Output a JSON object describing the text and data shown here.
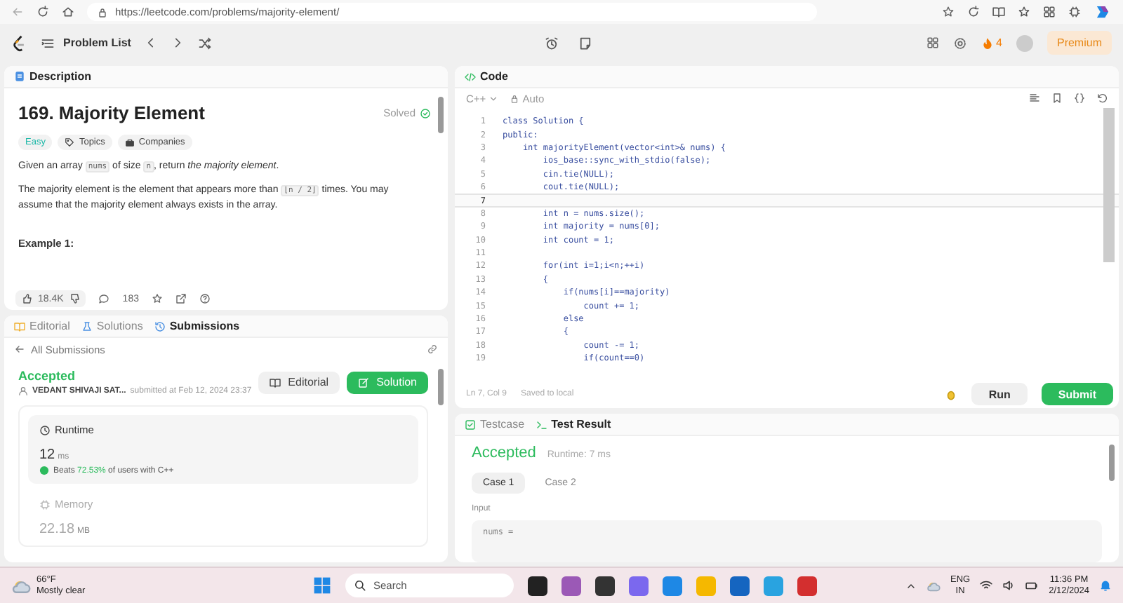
{
  "browser": {
    "url": "https://leetcode.com/problems/majority-element/"
  },
  "app_bar": {
    "problem_list": "Problem List",
    "streak": "4",
    "premium": "Premium"
  },
  "description": {
    "tab": "Description",
    "title": "169. Majority Element",
    "status": "Solved",
    "difficulty": "Easy",
    "tags": [
      "Topics",
      "Companies"
    ],
    "paragraphs": [
      [
        {
          "kind": "text",
          "text": "Given an array "
        },
        {
          "kind": "code",
          "text": "nums"
        },
        {
          "kind": "text",
          "text": " of size "
        },
        {
          "kind": "code",
          "text": "n"
        },
        {
          "kind": "text",
          "text": ", return "
        },
        {
          "kind": "italic",
          "text": "the majority element"
        },
        {
          "kind": "text",
          "text": "."
        }
      ],
      [
        {
          "kind": "text",
          "text": "The majority element is the element that appears more than "
        },
        {
          "kind": "code",
          "text": "⌊n / 2⌋"
        },
        {
          "kind": "text",
          "text": " times. You may assume that the majority element always exists in the array."
        }
      ]
    ],
    "example_heading": "Example 1:",
    "likes": "18.4K",
    "comments": "183"
  },
  "submissions": {
    "tabs": [
      {
        "label": "Editorial",
        "selected": false
      },
      {
        "label": "Solutions",
        "selected": false
      },
      {
        "label": "Submissions",
        "selected": true
      }
    ],
    "back_link": "All Submissions",
    "status": "Accepted",
    "user": "VEDANT SHIVAJI SAT...",
    "submitted": "submitted at Feb 12, 2024 23:37",
    "buttons": [
      {
        "label": "Editorial",
        "kind": "secondary"
      },
      {
        "label": "Solution",
        "kind": "primary"
      }
    ],
    "runtime": {
      "label": "Runtime",
      "value": "12",
      "unit": "ms",
      "beats_prefix": "Beats",
      "beats": "72.53%",
      "beats_suffix": "of users with C++"
    },
    "memory": {
      "label": "Memory",
      "value": "22.18",
      "unit": "MB"
    }
  },
  "code": {
    "tab": "Code",
    "language": "C++",
    "mode": "Auto",
    "lines": [
      {
        "n": "1",
        "text": "class Solution {",
        "current": false
      },
      {
        "n": "2",
        "text": "public:",
        "current": false
      },
      {
        "n": "3",
        "text": "    int majorityElement(vector<int>& nums) {",
        "current": false
      },
      {
        "n": "4",
        "text": "        ios_base::sync_with_stdio(false);",
        "current": false
      },
      {
        "n": "5",
        "text": "        cin.tie(NULL);",
        "current": false
      },
      {
        "n": "6",
        "text": "        cout.tie(NULL);",
        "current": false
      },
      {
        "n": "7",
        "current": true
      },
      {
        "n": "8",
        "text": "        int n = nums.size();",
        "current": false
      },
      {
        "n": "9",
        "text": "        int majority = nums[0];",
        "current": false
      },
      {
        "n": "10",
        "text": "        int count = 1;",
        "current": false
      },
      {
        "n": "11",
        "current": false
      },
      {
        "n": "12",
        "text": "        for(int i=1;i<n;++i)",
        "current": false
      },
      {
        "n": "13",
        "text": "        {",
        "current": false
      },
      {
        "n": "14",
        "text": "            if(nums[i]==majority)",
        "current": false
      },
      {
        "n": "15",
        "text": "                count += 1;",
        "current": false
      },
      {
        "n": "16",
        "text": "            else",
        "current": false
      },
      {
        "n": "17",
        "text": "            {",
        "current": false
      },
      {
        "n": "18",
        "text": "                count -= 1;",
        "current": false
      },
      {
        "n": "19",
        "text": "                if(count==0)",
        "current": false
      }
    ],
    "cursor": "Ln 7, Col 9",
    "saved": "Saved to local",
    "run": "Run",
    "submit": "Submit"
  },
  "result": {
    "tabs": [
      {
        "label": "Testcase",
        "selected": false
      },
      {
        "label": "Test Result",
        "selected": true
      }
    ],
    "verdict": "Accepted",
    "runtime": "Runtime: 7 ms",
    "cases": [
      {
        "label": "Case 1",
        "selected": true
      },
      {
        "label": "Case 2",
        "selected": false
      }
    ],
    "input_label": "Input",
    "input_var": "nums ="
  },
  "taskbar": {
    "temperature": "66°F",
    "weather": "Mostly clear",
    "search_placeholder": "Search",
    "language": "ENG",
    "region": "IN",
    "time": "11:36 PM",
    "date": "2/12/2024"
  }
}
